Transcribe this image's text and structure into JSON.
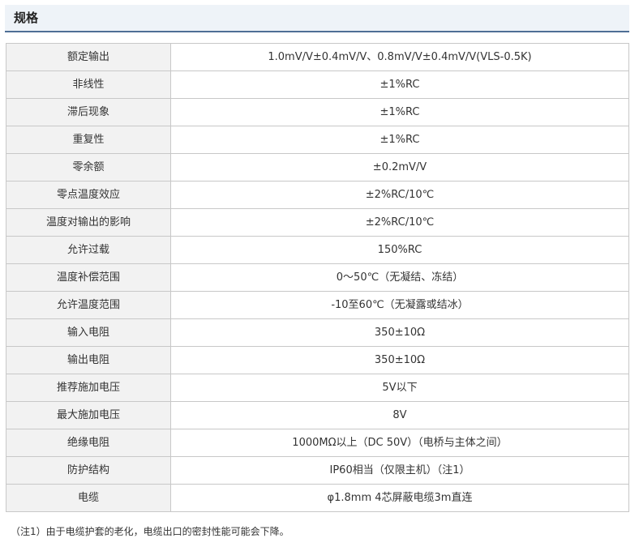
{
  "section": {
    "title": "规格"
  },
  "spec_rows": [
    {
      "label": "额定输出",
      "value": "1.0mV/V±0.4mV/V、0.8mV/V±0.4mV/V(VLS-0.5K)"
    },
    {
      "label": "非线性",
      "value": "±1%RC"
    },
    {
      "label": "滞后现象",
      "value": "±1%RC"
    },
    {
      "label": "重复性",
      "value": "±1%RC"
    },
    {
      "label": "零余额",
      "value": "±0.2mV/V"
    },
    {
      "label": "零点温度效应",
      "value": "±2%RC/10℃"
    },
    {
      "label": "温度对输出的影响",
      "value": "±2%RC/10℃"
    },
    {
      "label": "允许过载",
      "value": "150%RC"
    },
    {
      "label": "温度补偿范围",
      "value": "0～50℃（无凝结、冻结）"
    },
    {
      "label": "允许温度范围",
      "value": "-10至60℃（无凝露或结冰）"
    },
    {
      "label": "输入电阻",
      "value": "350±10Ω"
    },
    {
      "label": "输出电阻",
      "value": "350±10Ω"
    },
    {
      "label": "推荐施加电压",
      "value": "5V以下"
    },
    {
      "label": "最大施加电压",
      "value": "8V"
    },
    {
      "label": "绝缘电阻",
      "value": "1000MΩ以上（DC 50V）（电桥与主体之间）"
    },
    {
      "label": "防护结构",
      "value": "IP60相当（仅限主机）（注1）"
    },
    {
      "label": "电缆",
      "value": "φ1.8mm 4芯屏蔽电缆3m直连"
    }
  ],
  "footnote": "（注1）由于电缆护套的老化，电缆出口的密封性能可能会下降。"
}
